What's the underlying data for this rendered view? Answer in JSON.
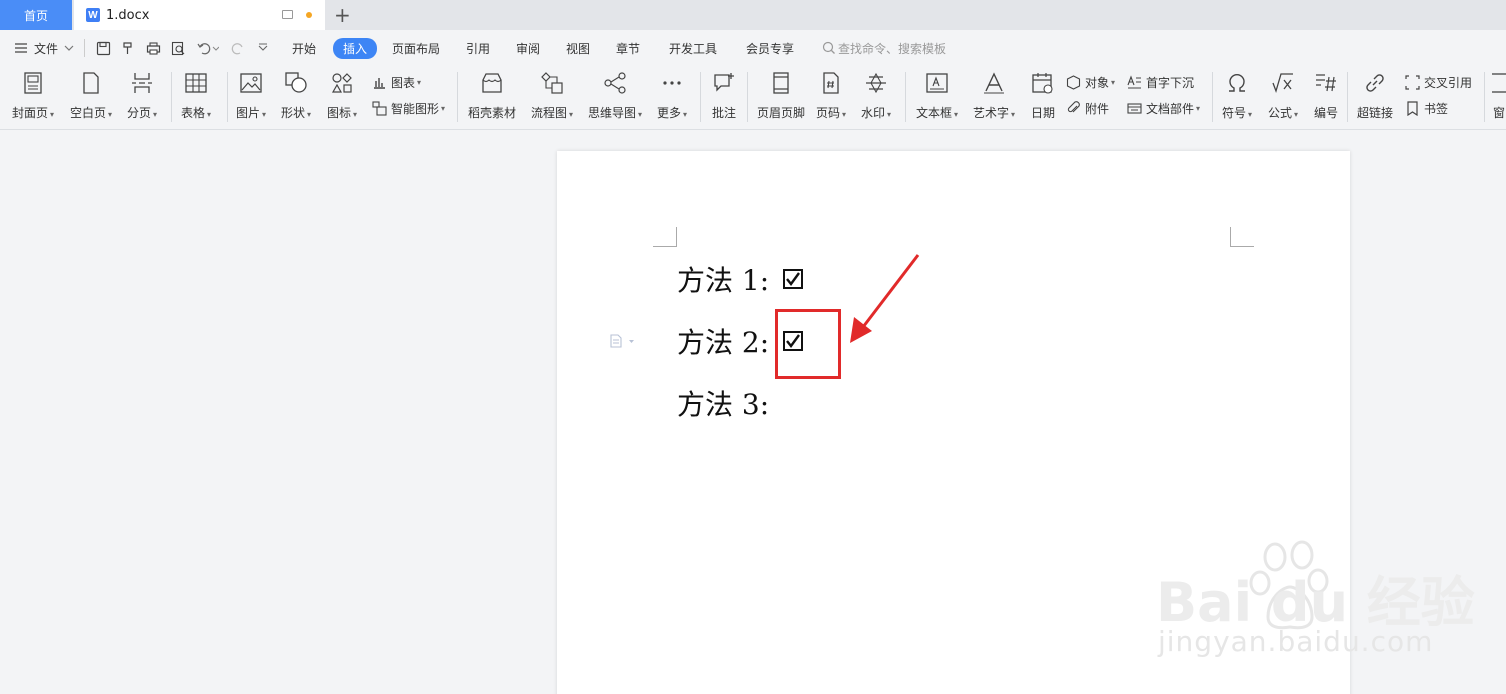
{
  "tabs": {
    "home_label": "首页",
    "doc_icon_letter": "W",
    "doc_title": "1.docx",
    "new_tab_symbol": "+"
  },
  "menu": {
    "file_label": "文件",
    "items": [
      "开始",
      "插入",
      "页面布局",
      "引用",
      "审阅",
      "视图",
      "章节",
      "开发工具",
      "会员专享"
    ],
    "active": "插入",
    "search_placeholder": "查找命令、搜索模板"
  },
  "ribbon": {
    "large": [
      {
        "label": "封面页",
        "icon": "cover-page-icon"
      },
      {
        "label": "空白页",
        "icon": "blank-page-icon"
      },
      {
        "label": "分页",
        "icon": "page-break-icon"
      },
      {
        "label": "表格",
        "icon": "table-icon"
      },
      {
        "label": "图片",
        "icon": "picture-icon"
      },
      {
        "label": "形状",
        "icon": "shape-icon"
      },
      {
        "label": "图标",
        "icon": "icons-icon"
      },
      {
        "label": "稻壳素材",
        "icon": "docer-material-icon"
      },
      {
        "label": "流程图",
        "icon": "flowchart-icon"
      },
      {
        "label": "思维导图",
        "icon": "mindmap-icon"
      },
      {
        "label": "更多",
        "icon": "more-icon"
      },
      {
        "label": "批注",
        "icon": "comment-icon"
      },
      {
        "label": "页眉页脚",
        "icon": "header-footer-icon"
      },
      {
        "label": "页码",
        "icon": "page-number-icon"
      },
      {
        "label": "水印",
        "icon": "watermark-icon"
      },
      {
        "label": "文本框",
        "icon": "textbox-icon"
      },
      {
        "label": "艺术字",
        "icon": "wordart-icon"
      },
      {
        "label": "日期",
        "icon": "date-icon"
      },
      {
        "label": "符号",
        "icon": "symbol-icon"
      },
      {
        "label": "公式",
        "icon": "formula-icon"
      },
      {
        "label": "编号",
        "icon": "numbering-icon"
      },
      {
        "label": "超链接",
        "icon": "hyperlink-icon"
      }
    ],
    "small": [
      {
        "label": "图表",
        "icon": "chart-icon"
      },
      {
        "label": "智能图形",
        "icon": "smartart-icon"
      },
      {
        "label": "对象",
        "icon": "object-icon"
      },
      {
        "label": "附件",
        "icon": "attachment-icon"
      },
      {
        "label": "首字下沉",
        "icon": "dropcap-icon"
      },
      {
        "label": "文档部件",
        "icon": "doc-parts-icon"
      },
      {
        "label": "交叉引用",
        "icon": "cross-reference-icon"
      },
      {
        "label": "书签",
        "icon": "bookmark-icon"
      },
      {
        "label": "窗",
        "icon": "window-icon"
      }
    ]
  },
  "document": {
    "lines": [
      {
        "text": "方法 1:",
        "checked": true
      },
      {
        "text": "方法 2:",
        "checked": true
      },
      {
        "text": "方法 3:",
        "checked": false
      }
    ]
  },
  "watermark": {
    "logo_text": "Bai du 经验",
    "url_text": "jingyan.baidu.com"
  },
  "colors": {
    "accent": "#3d85f5",
    "highlight": "#e12a2a"
  }
}
